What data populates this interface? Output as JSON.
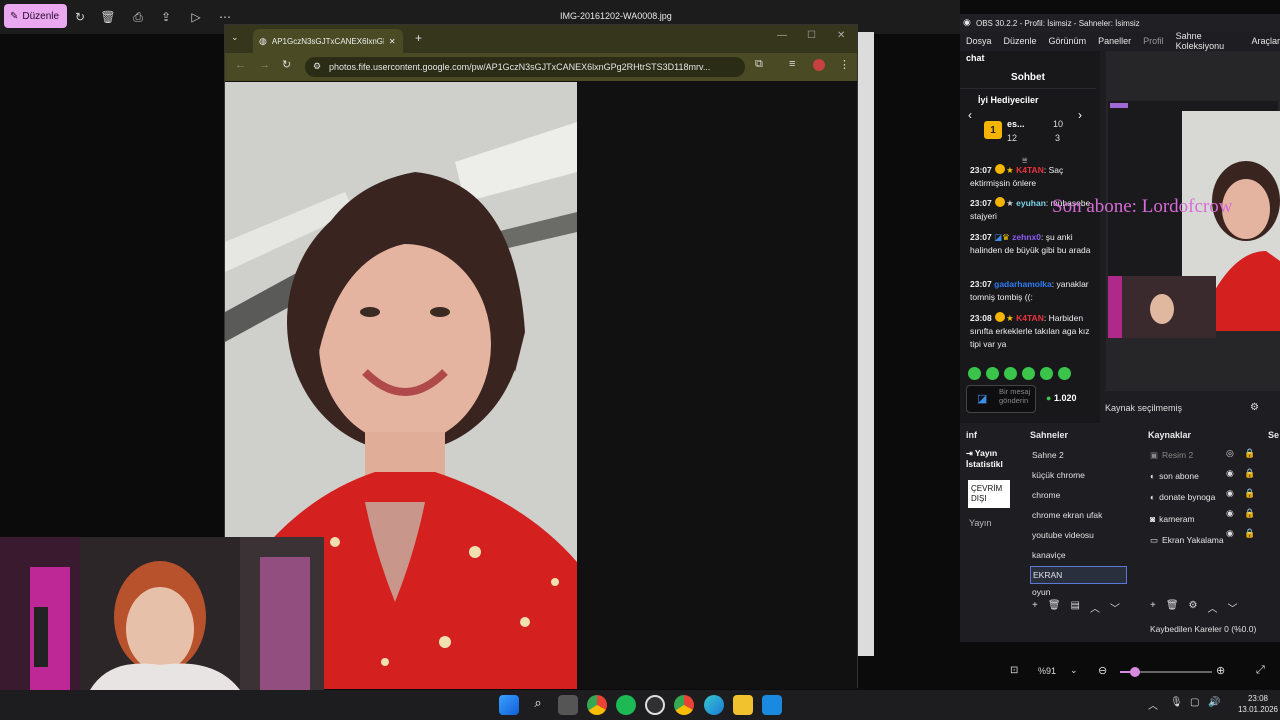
{
  "viewer": {
    "edit_label": "Düzenle",
    "file_title": "IMG-20161202-WA0008.jpg",
    "zoom_level": "%91"
  },
  "browser": {
    "tab_title": "AP1GczN3sGJTxCANEX6lxnGP",
    "url": "photos.fife.usercontent.google.com/pw/AP1GczN3sGJTxCANEX6lxnGPg2RHtrSTS3D118mrv..."
  },
  "obs": {
    "title": "OBS 30.2.2 - Profil: İsimsiz - Sahneler: İsimsiz",
    "menu": [
      "Dosya",
      "Düzenle",
      "Görünüm",
      "Paneller",
      "Profil",
      "Sahne Koleksiyonu",
      "Araçlar"
    ],
    "chat_dock_title": "chat",
    "chat_header": "Sohbet",
    "top_gifters_title": "İyi Hediyeciler",
    "gifter": {
      "rank": "1",
      "name": "es...",
      "a": "10",
      "b": "12",
      "c": "3"
    },
    "messages": [
      {
        "time": "23:07",
        "user": "K4TAN",
        "user_color": "#e8323c",
        "text": "Saç ektirmişsin önlere"
      },
      {
        "time": "23:07",
        "user": "eyuhan",
        "user_color": "#7cd4e8",
        "text": "muhasebe stajyeri"
      },
      {
        "time": "23:07",
        "user": "zehnx0",
        "user_color": "#8a5cf5",
        "text": "şu anki halinden de büyük gibi bu arada"
      },
      {
        "time": "23:07",
        "user": "gadarhamolka",
        "user_color": "#2e7cf6",
        "text": "yanaklar tomniş tombiş ((:"
      },
      {
        "time": "23:08",
        "user": "K4TAN",
        "user_color": "#e8323c",
        "text": "Harbiden sınıfta erkeklerle takılan aga kız tipi var ya"
      }
    ],
    "chat_input_placeholder": "Bir mesaj gönderin",
    "points": "1.020",
    "no_source": "Kaynak seçilmemiş",
    "info_title": "inf",
    "stream_stats": "Yayın İstatistikl",
    "status_offline": "ÇEVRİM DIŞI",
    "stream_label": "Yayın",
    "scenes_title": "Sahneler",
    "scenes": [
      "Sahne 2",
      "küçük chrome",
      "chrome",
      "chrome ekran ufak",
      "youtube videosu",
      "kanaviçe",
      "EKRAN",
      "oyun"
    ],
    "selected_scene": "EKRAN",
    "sources_title": "Kaynaklar",
    "sources": [
      "Resim 2",
      "son abone",
      "donate bynoga",
      "kameram",
      "Ekran Yakalama"
    ],
    "sound_title": "Se",
    "dropped_frames": "Kaybedilen Kareler 0 (%0.0)",
    "overlay_text": "Son abone: Lordofcrow"
  },
  "taskbar": {
    "time": "23:08",
    "date": "13.01.2026"
  }
}
